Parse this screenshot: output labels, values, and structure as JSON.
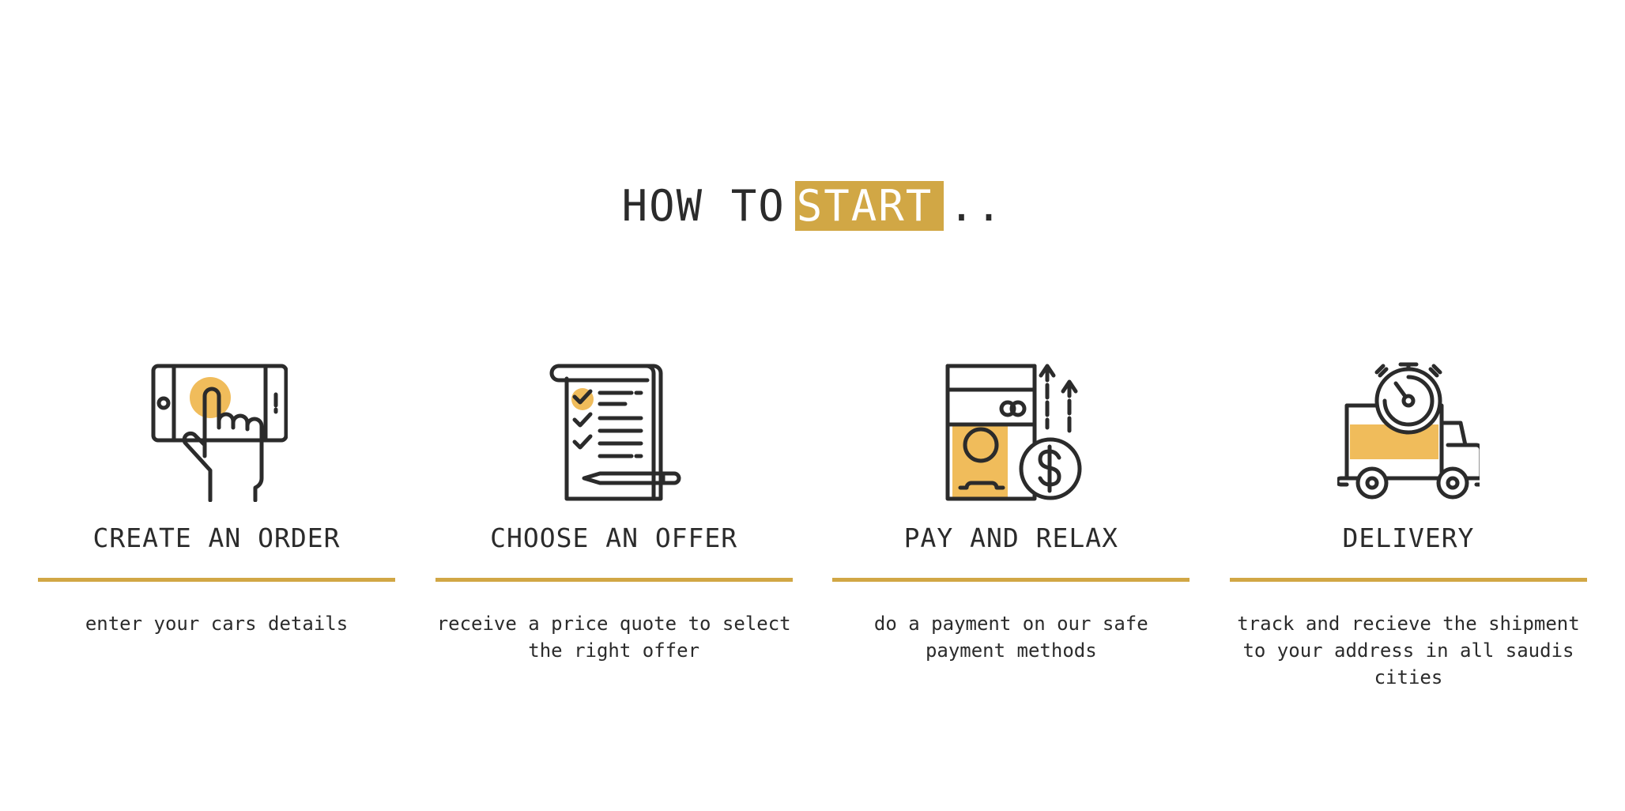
{
  "heading": {
    "prefix": "HOW TO",
    "highlight": "START",
    "suffix": ".."
  },
  "colors": {
    "accent": "#d1a745",
    "icon_fill": "#f0bc5b",
    "text": "#2b2b2b"
  },
  "steps": [
    {
      "icon": "phone-tap-icon",
      "title": "CREATE AN ORDER",
      "description": "enter your cars details"
    },
    {
      "icon": "checklist-icon",
      "title": "CHOOSE AN OFFER",
      "description": "receive a price quote to select the right offer"
    },
    {
      "icon": "payment-icon",
      "title": "PAY AND RELAX",
      "description": "do a payment on our safe payment methods"
    },
    {
      "icon": "delivery-truck-icon",
      "title": "DELIVERY",
      "description": "track and recieve the shipment to your address in all saudis cities"
    }
  ]
}
